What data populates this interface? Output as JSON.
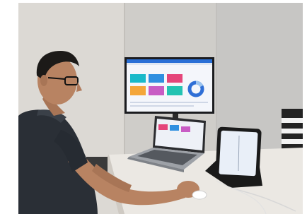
{
  "scene": {
    "description_tags": [
      "man-at-desk",
      "wall-monitor-dashboard",
      "laptop-dashboard",
      "tablet-on-stand"
    ],
    "colors": {
      "wall_left": "#d9d6d1",
      "wall_right": "#c9c8c6",
      "desk": "#e9e6e1",
      "monitor_bezel": "#1b1c1f",
      "dashboard_bg": "#f4f6fb",
      "dashboard_header": "#2a6fd6",
      "tile_cyan": "#19b9c9",
      "tile_blue": "#2f8fe0",
      "tile_pink": "#e5457a",
      "tile_orange": "#f4a63a",
      "tile_magenta": "#c85cc4",
      "tile_teal": "#23c3b2",
      "donut_blue": "#2f6fd6",
      "donut_light": "#9cc4ef",
      "shirt": "#2a2f36",
      "skin": "#b88362",
      "hair": "#1c1a18"
    }
  }
}
